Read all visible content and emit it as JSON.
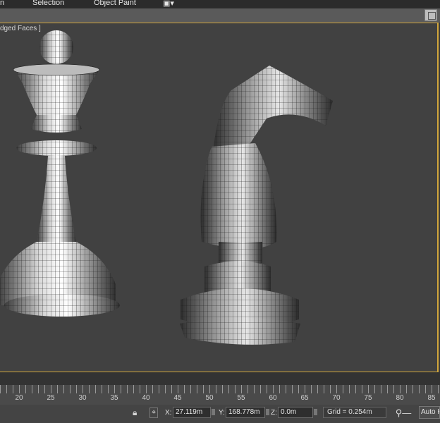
{
  "menubar": {
    "items": [
      "n",
      "Selection",
      "Object Paint"
    ],
    "camera_icon": "camera-icon"
  },
  "viewport": {
    "label": "dged Faces ]",
    "objects": [
      "queen-chess-piece",
      "knight-chess-piece"
    ],
    "border_color": "#d2a63b"
  },
  "timeline": {
    "ticks": [
      "20",
      "25",
      "30",
      "35",
      "40",
      "45",
      "50",
      "55",
      "60",
      "65",
      "70",
      "75",
      "80",
      "85"
    ]
  },
  "statusbar": {
    "lock_icon": "lock-icon",
    "transform_icon": "transform-type-in-icon",
    "x_label": "X:",
    "x_value": "27.119m",
    "y_label": "Y:",
    "y_value": "168.778m",
    "z_label": "Z:",
    "z_value": "0.0m",
    "grid": "Grid = 0.254m",
    "key_icon": "key-icon",
    "auto_key": "Auto Ke"
  }
}
